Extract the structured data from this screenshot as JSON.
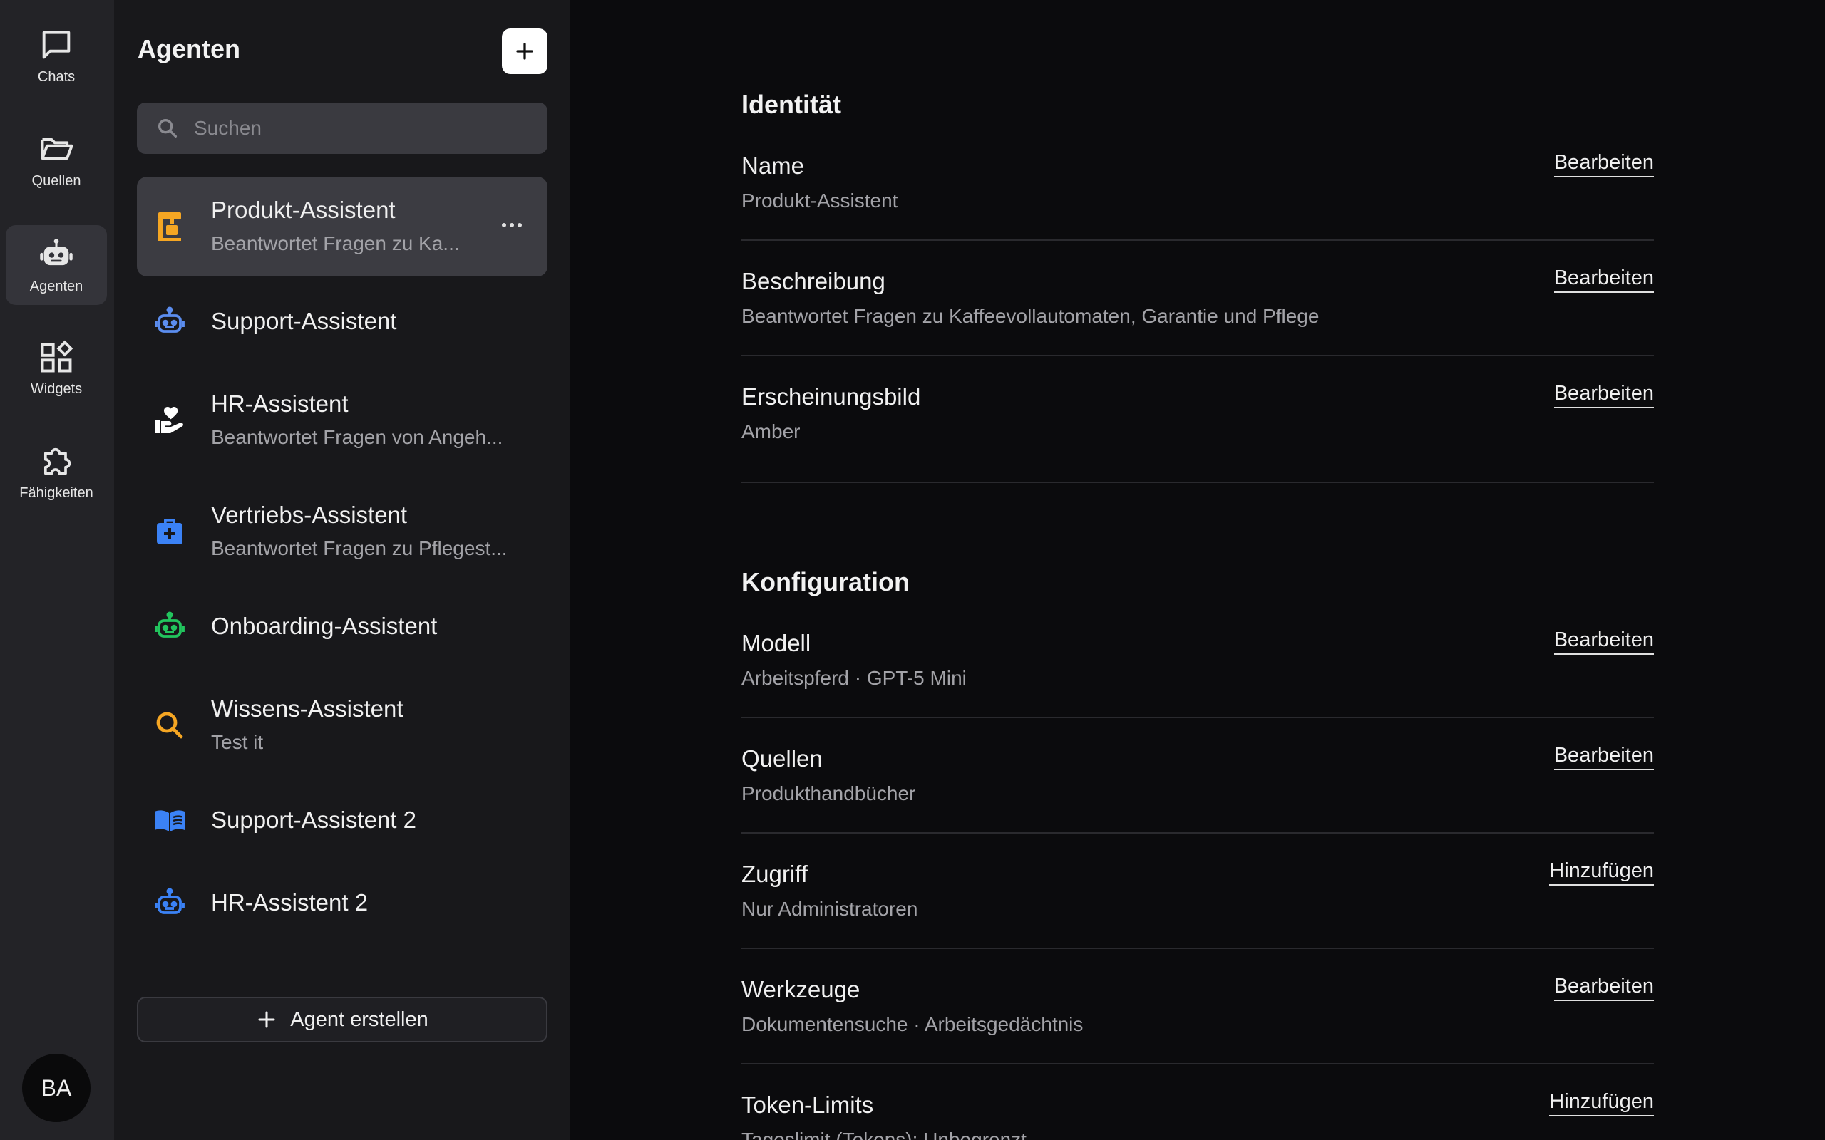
{
  "rail": {
    "items": [
      {
        "label": "Chats",
        "icon": "chat-icon"
      },
      {
        "label": "Quellen",
        "icon": "folder-icon"
      },
      {
        "label": "Agenten",
        "icon": "robot-icon",
        "active": true
      },
      {
        "label": "Widgets",
        "icon": "widgets-icon"
      },
      {
        "label": "Fähigkeiten",
        "icon": "puzzle-icon"
      }
    ],
    "avatar": "BA"
  },
  "panel": {
    "title": "Agenten",
    "search_placeholder": "Suchen",
    "agents": [
      {
        "name": "Produkt-Assistent",
        "desc": "Beantwortet Fragen zu Ka...",
        "icon": "coffee-machine-icon",
        "color": "#f5a623",
        "active": true
      },
      {
        "name": "Support-Assistent",
        "desc": "",
        "icon": "robot-icon",
        "color": "#5b8def"
      },
      {
        "name": "HR-Assistent",
        "desc": "Beantwortet Fragen von Angeh...",
        "icon": "heart-hand-icon",
        "color": "#ffffff"
      },
      {
        "name": "Vertriebs-Assistent",
        "desc": "Beantwortet Fragen zu Pflegest...",
        "icon": "medical-bag-icon",
        "color": "#3b82f6"
      },
      {
        "name": "Onboarding-Assistent",
        "desc": "",
        "icon": "robot-icon",
        "color": "#22c55e"
      },
      {
        "name": "Wissens-Assistent",
        "desc": "Test it",
        "icon": "search-icon",
        "color": "#f5a623"
      },
      {
        "name": "Support-Assistent 2",
        "desc": "",
        "icon": "book-icon",
        "color": "#3b82f6"
      },
      {
        "name": "HR-Assistent 2",
        "desc": "",
        "icon": "robot-icon",
        "color": "#3b82f6"
      }
    ],
    "create_label": "Agent erstellen"
  },
  "main": {
    "identity_title": "Identität",
    "identity_rows": [
      {
        "label": "Name",
        "value": "Produkt-Assistent",
        "action": "Bearbeiten"
      },
      {
        "label": "Beschreibung",
        "value": "Beantwortet Fragen zu Kaffeevollautomaten, Garantie und Pflege",
        "action": "Bearbeiten"
      },
      {
        "label": "Erscheinungsbild",
        "value": "Amber",
        "action": "Bearbeiten"
      }
    ],
    "config_title": "Konfiguration",
    "config_rows": [
      {
        "label": "Modell",
        "value": "Arbeitspferd · GPT-5 Mini",
        "action": "Bearbeiten"
      },
      {
        "label": "Quellen",
        "value": "Produkthandbücher",
        "action": "Bearbeiten"
      },
      {
        "label": "Zugriff",
        "value": "Nur Administratoren",
        "action": "Hinzufügen"
      },
      {
        "label": "Werkzeuge",
        "value": "Dokumentensuche · Arbeitsgedächtnis",
        "action": "Bearbeiten"
      },
      {
        "label": "Token-Limits",
        "value": "Tageslimit (Tokens): Unbegrenzt",
        "action": "Hinzufügen"
      }
    ]
  }
}
